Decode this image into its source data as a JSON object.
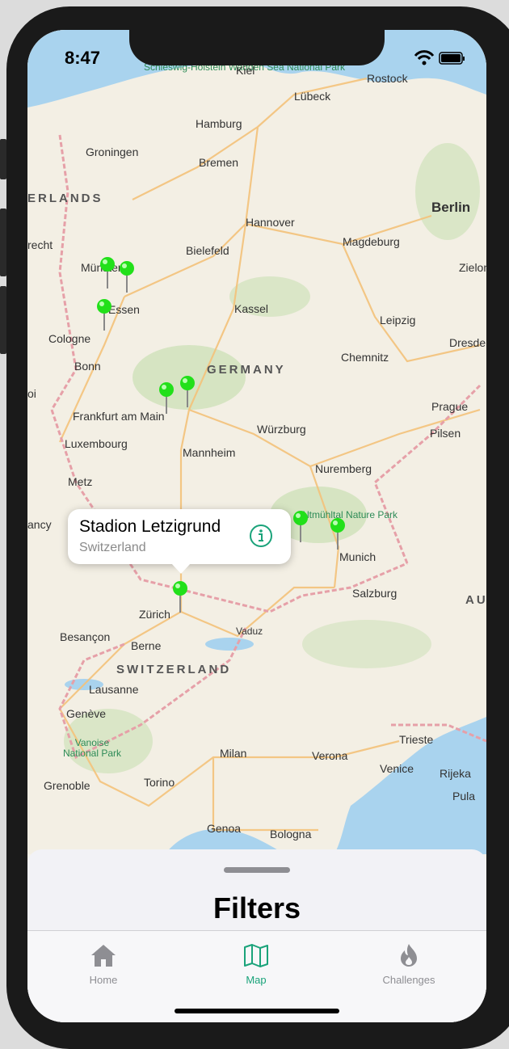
{
  "status_bar": {
    "time": "8:47"
  },
  "map": {
    "cities": [
      "Schleswig-Holstein Wadden Sea National Park",
      "Kiel",
      "Rostock",
      "Lübeck",
      "Hamburg",
      "Groningen",
      "Bremen",
      "Berlin",
      "Hannover",
      "Magdeburg",
      "Bielefeld",
      "Münster",
      "Essen",
      "Kassel",
      "Leipzig",
      "Cologne",
      "Bonn",
      "Chemnitz",
      "Dresden",
      "Frankfurt am Main",
      "Prague",
      "Pilsen",
      "Würzburg",
      "Luxembourg",
      "Mannheim",
      "Nuremberg",
      "Metz",
      "Munich",
      "Salzburg",
      "Zürich",
      "Vaduz",
      "Besançon",
      "Berne",
      "Lausanne",
      "Genève",
      "Vanoise National Park",
      "Grenoble",
      "Torino",
      "Milan",
      "Verona",
      "Trieste",
      "Venice",
      "Rijeka",
      "Pula",
      "Genoa",
      "Bologna",
      "Zielona",
      "Altmühltal Nature Park"
    ],
    "countries": [
      "GERMANY",
      "SWITZERLAND",
      "ERLANDS",
      "AU"
    ],
    "edge_fragments": [
      "recht",
      "oi",
      "ancy"
    ],
    "pin_color": "#22e01a"
  },
  "callout": {
    "title": "Stadion Letzigrund",
    "subtitle": "Switzerland",
    "accent": "#1aa37a"
  },
  "sheet": {
    "title": "Filters"
  },
  "tabs": [
    {
      "label": "Home",
      "icon": "house-icon",
      "active": false
    },
    {
      "label": "Map",
      "icon": "map-icon",
      "active": true
    },
    {
      "label": "Challenges",
      "icon": "flame-icon",
      "active": false
    }
  ],
  "colors": {
    "active_tab": "#1aa37a",
    "inactive_tab": "#8e8e93",
    "water": "#a9d3ee",
    "land": "#f3efe4",
    "roads": "#f4c27a",
    "border": "#e6a0a8",
    "forest": "#c9e0b4"
  }
}
